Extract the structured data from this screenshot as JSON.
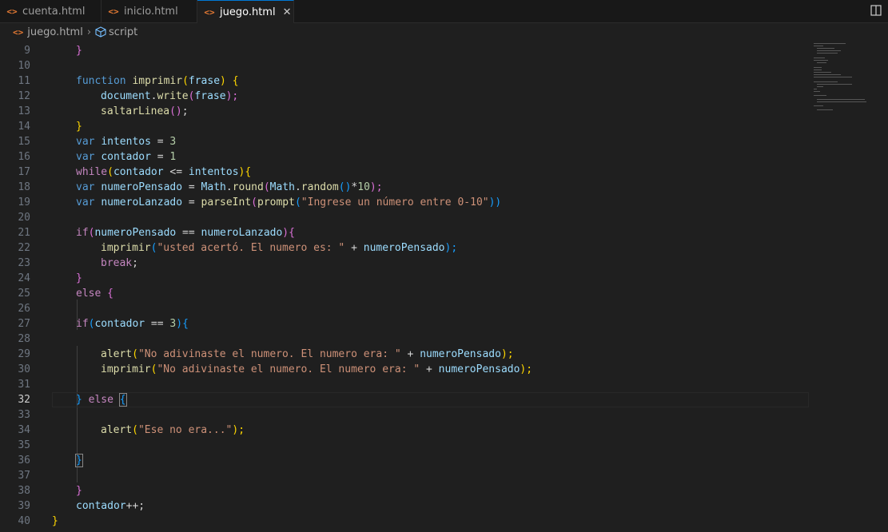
{
  "tabs": [
    {
      "label": "cuenta.html",
      "icon": "<>",
      "active": false
    },
    {
      "label": "inicio.html",
      "icon": "<>",
      "active": false
    },
    {
      "label": "juego.html",
      "icon": "<>",
      "active": true,
      "close": "✕"
    }
  ],
  "breadcrumb": {
    "icon": "<>",
    "file": "juego.html",
    "sep": "›",
    "symbol": "script"
  },
  "line_numbers": [
    "9",
    "10",
    "11",
    "12",
    "13",
    "14",
    "15",
    "16",
    "17",
    "18",
    "19",
    "20",
    "21",
    "22",
    "23",
    "24",
    "25",
    "26",
    "27",
    "28",
    "29",
    "30",
    "31",
    "32",
    "33",
    "34",
    "35",
    "36",
    "37",
    "38",
    "39",
    "40"
  ],
  "current_line": "32",
  "colors": {
    "accent": "#0078d4",
    "tab_icon": "#e37933",
    "background": "#1f1f1f"
  },
  "code": {
    "l9": [
      "}"
    ],
    "l11": [
      "function",
      " ",
      "imprimir",
      "(",
      "frase",
      ")",
      " ",
      "{"
    ],
    "l12": [
      "document",
      ".",
      "write",
      "(",
      "frase",
      ");"
    ],
    "l13": [
      "saltarLinea",
      "()",
      ";"
    ],
    "l14": [
      "}"
    ],
    "l15": [
      "var",
      " ",
      "intentos",
      " = ",
      "3"
    ],
    "l16": [
      "var",
      " ",
      "contador",
      " = ",
      "1"
    ],
    "l17": [
      "while",
      "(",
      "contador",
      " <= ",
      "intentos",
      ")",
      "{"
    ],
    "l18": [
      "var",
      " ",
      "numeroPensado",
      " = ",
      "Math",
      ".",
      "round",
      "(",
      "Math",
      ".",
      "random",
      "()",
      "*",
      "10",
      ");"
    ],
    "l19": [
      "var",
      " ",
      "numeroLanzado",
      " = ",
      "parseInt",
      "(",
      "prompt",
      "(",
      "\"Ingrese un número entre 0-10\"",
      "))"
    ],
    "l21": [
      "if",
      "(",
      "numeroPensado",
      " == ",
      "numeroLanzado",
      ")",
      "{"
    ],
    "l22": [
      "imprimir",
      "(",
      "\"usted acertó. El numero es: \"",
      " + ",
      "numeroPensado",
      ");"
    ],
    "l23": [
      "break",
      ";"
    ],
    "l24": [
      "}"
    ],
    "l25": [
      "else",
      " ",
      "{"
    ],
    "l27": [
      "if",
      "(",
      "contador",
      " == ",
      "3",
      ")",
      "{"
    ],
    "l29": [
      "alert",
      "(",
      "\"No adivinaste el numero. El numero era: \"",
      " + ",
      "numeroPensado",
      ");"
    ],
    "l30": [
      "imprimir",
      "(",
      "\"No adivinaste el numero. El numero era: \"",
      " + ",
      "numeroPensado",
      ");"
    ],
    "l32": [
      "}",
      " ",
      "else",
      " ",
      "{"
    ],
    "l34": [
      "alert",
      "(",
      "\"Ese no era...\"",
      ");"
    ],
    "l36": [
      "}"
    ],
    "l38": [
      "}"
    ],
    "l39": [
      "contador",
      "++;"
    ],
    "l40": [
      "}"
    ]
  }
}
